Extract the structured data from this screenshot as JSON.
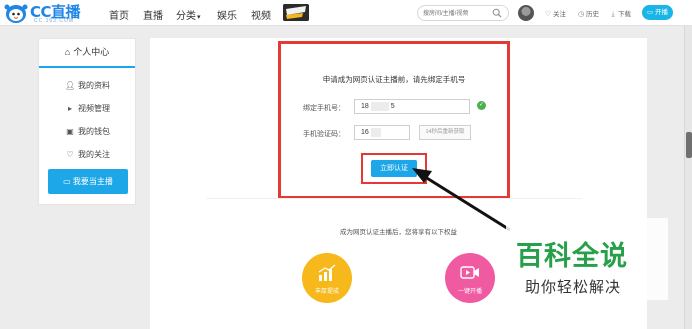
{
  "header": {
    "logo_text": "CC直播",
    "logo_sub": "CC.163.COM",
    "nav": [
      "首页",
      "直播",
      "分类",
      "娱乐",
      "视频"
    ],
    "search_placeholder": "搜房间/主播/视频",
    "tools": {
      "follow": "关注",
      "history": "历史",
      "download": "下载"
    },
    "live_button": "开播"
  },
  "sidebar": {
    "title": "个人中心",
    "items": [
      "我的资料",
      "视频管理",
      "我的钱包",
      "我的关注"
    ],
    "cta": "我要当主播"
  },
  "form": {
    "title": "申请成为网页认证主播前，请先绑定手机号",
    "phone_label": "绑定手机号：",
    "phone_prefix": "18",
    "phone_suffix": "5",
    "code_label": "手机验证码：",
    "code_prefix": "16",
    "code_button": "14秒后重新获取",
    "submit": "立即认证"
  },
  "benefits": {
    "heading": "成为网页认证主播后，您将享有以下权益",
    "items": [
      "丰厚提成",
      "一键开播"
    ]
  },
  "watermark": {
    "title": "百科全说",
    "subtitle": "助你轻松解决"
  },
  "colors": {
    "accent": "#1ea7e8",
    "highlight_red": "#e53935",
    "benefit_gold": "#f6b81a",
    "benefit_pink": "#f05aa0",
    "watermark_green": "#27a04a"
  }
}
